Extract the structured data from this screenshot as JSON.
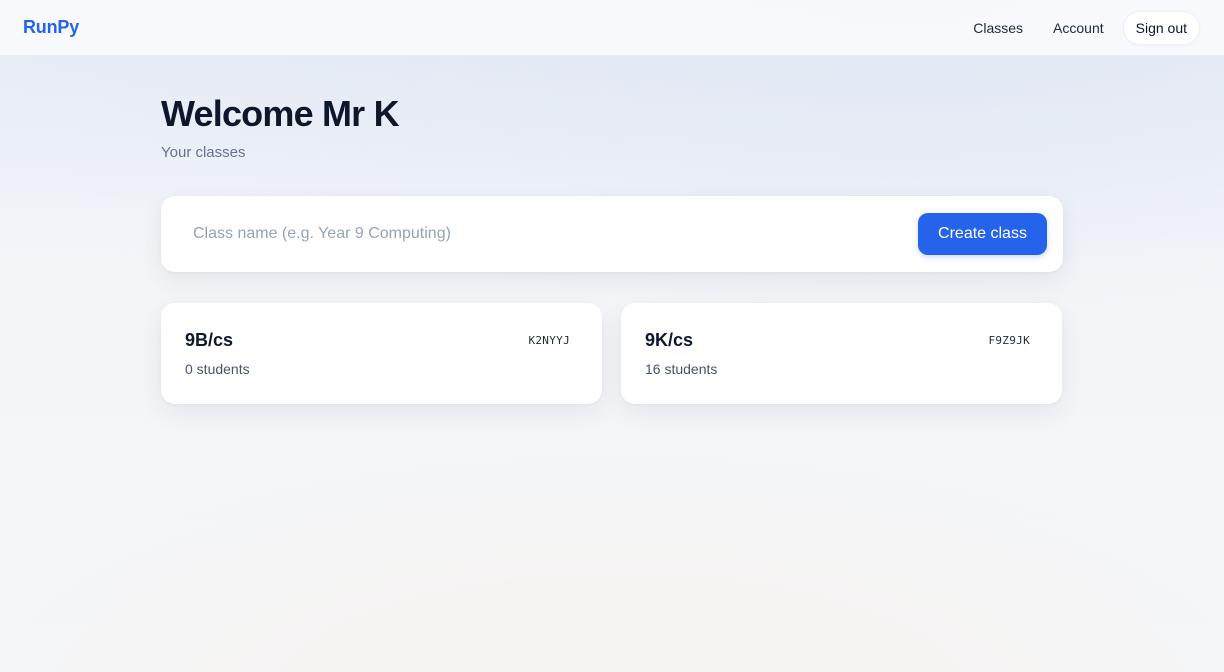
{
  "header": {
    "brand": "RunPy",
    "nav": {
      "classes": "Classes",
      "account": "Account",
      "sign_out": "Sign out"
    }
  },
  "main": {
    "title": "Welcome Mr K",
    "subtitle": "Your classes",
    "create": {
      "placeholder": "Class name (e.g. Year 9 Computing)",
      "value": "",
      "button_label": "Create class"
    },
    "classes": [
      {
        "name": "9B/cs",
        "code": "K2NYYJ",
        "students": "0 students"
      },
      {
        "name": "9K/cs",
        "code": "F9Z9JK",
        "students": "16 students"
      }
    ]
  },
  "colors": {
    "accent": "#2563eb",
    "text": "#0f172a",
    "muted": "#64748b"
  }
}
